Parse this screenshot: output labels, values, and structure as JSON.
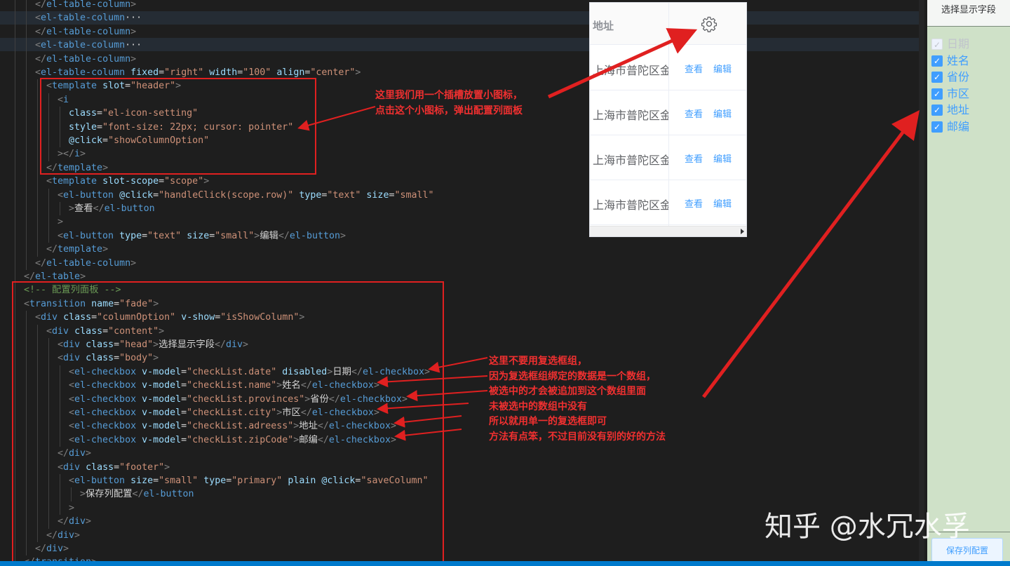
{
  "code_lines": [
    {
      "indent": 3,
      "html": "<span class='pn'>&lt;/</span><span class='tg'>el-table-column</span><span class='pn'>&gt;</span>"
    },
    {
      "indent": 3,
      "html": "<span class='pn'>&lt;</span><span class='tg'>el-table-column</span><span class='fold'>···</span>"
    },
    {
      "indent": 3,
      "html": "<span class='pn'>&lt;/</span><span class='tg'>el-table-column</span><span class='pn'>&gt;</span>"
    },
    {
      "indent": 3,
      "html": "<span class='pn'>&lt;</span><span class='tg'>el-table-column</span><span class='fold'>···</span>"
    },
    {
      "indent": 3,
      "html": "<span class='pn'>&lt;/</span><span class='tg'>el-table-column</span><span class='pn'>&gt;</span>"
    },
    {
      "indent": 3,
      "html": "<span class='pn'>&lt;</span><span class='tg'>el-table-column</span> <span class='at'>fixed</span>=<span class='st'>\"right\"</span> <span class='at'>width</span>=<span class='st'>\"100\"</span> <span class='at'>align</span>=<span class='st'>\"center\"</span><span class='pn'>&gt;</span>"
    },
    {
      "indent": 4,
      "html": "<span class='pn'>&lt;</span><span class='tg'>template</span> <span class='at'>slot</span>=<span class='st'>\"header\"</span><span class='pn'>&gt;</span>"
    },
    {
      "indent": 5,
      "html": "<span class='pn'>&lt;</span><span class='tg'>i</span>"
    },
    {
      "indent": 6,
      "html": "<span class='at'>class</span>=<span class='st'>\"el-icon-setting\"</span>"
    },
    {
      "indent": 6,
      "html": "<span class='at'>style</span>=<span class='st'>\"font-size: 22px; cursor: pointer\"</span>"
    },
    {
      "indent": 6,
      "html": "<span class='at'>@click</span>=<span class='st'>\"showColumnOption\"</span>"
    },
    {
      "indent": 5,
      "html": "<span class='pn'>&gt;&lt;/</span><span class='tg'>i</span><span class='pn'>&gt;</span>"
    },
    {
      "indent": 4,
      "html": "<span class='pn'>&lt;/</span><span class='tg'>template</span><span class='pn'>&gt;</span>"
    },
    {
      "indent": 4,
      "html": "<span class='pn'>&lt;</span><span class='tg'>template</span> <span class='at'>slot-scope</span>=<span class='st'>\"scope\"</span><span class='pn'>&gt;</span>"
    },
    {
      "indent": 5,
      "html": "<span class='pn'>&lt;</span><span class='tg'>el-button</span> <span class='at'>@click</span>=<span class='st'>\"handleClick(scope.row)\"</span> <span class='at'>type</span>=<span class='st'>\"text\"</span> <span class='at'>size</span>=<span class='st'>\"small\"</span>"
    },
    {
      "indent": 6,
      "html": "<span class='pn'>&gt;</span><span class='cjk'>查看</span><span class='pn'>&lt;/</span><span class='tg'>el-button</span>"
    },
    {
      "indent": 5,
      "html": "<span class='pn'>&gt;</span>"
    },
    {
      "indent": 5,
      "html": "<span class='pn'>&lt;</span><span class='tg'>el-button</span> <span class='at'>type</span>=<span class='st'>\"text\"</span> <span class='at'>size</span>=<span class='st'>\"small\"</span><span class='pn'>&gt;</span><span class='cjk'>编辑</span><span class='pn'>&lt;/</span><span class='tg'>el-button</span><span class='pn'>&gt;</span>"
    },
    {
      "indent": 4,
      "html": "<span class='pn'>&lt;/</span><span class='tg'>template</span><span class='pn'>&gt;</span>"
    },
    {
      "indent": 3,
      "html": "<span class='pn'>&lt;/</span><span class='tg'>el-table-column</span><span class='pn'>&gt;</span>"
    },
    {
      "indent": 2,
      "html": "<span class='pn'>&lt;/</span><span class='tg'>el-table</span><span class='pn'>&gt;</span>"
    },
    {
      "indent": 2,
      "html": "<span class='cm'>&lt;!-- <span class='cjk'>配置列面板</span> --&gt;</span>"
    },
    {
      "indent": 2,
      "html": "<span class='pn'>&lt;</span><span class='tg'>transition</span> <span class='at'>name</span>=<span class='st'>\"fade\"</span><span class='pn'>&gt;</span>"
    },
    {
      "indent": 3,
      "html": "<span class='pn'>&lt;</span><span class='tg'>div</span> <span class='at'>class</span>=<span class='st'>\"columnOption\"</span> <span class='at'>v-show</span>=<span class='st'>\"isShowColumn\"</span><span class='pn'>&gt;</span>"
    },
    {
      "indent": 4,
      "html": "<span class='pn'>&lt;</span><span class='tg'>div</span> <span class='at'>class</span>=<span class='st'>\"content\"</span><span class='pn'>&gt;</span>"
    },
    {
      "indent": 5,
      "html": "<span class='pn'>&lt;</span><span class='tg'>div</span> <span class='at'>class</span>=<span class='st'>\"head\"</span><span class='pn'>&gt;</span><span class='cjk'>选择显示字段</span><span class='pn'>&lt;/</span><span class='tg'>div</span><span class='pn'>&gt;</span>"
    },
    {
      "indent": 5,
      "html": "<span class='pn'>&lt;</span><span class='tg'>div</span> <span class='at'>class</span>=<span class='st'>\"body\"</span><span class='pn'>&gt;</span>"
    },
    {
      "indent": 6,
      "html": "<span class='pn'>&lt;</span><span class='tg'>el-checkbox</span> <span class='at'>v-model</span>=<span class='st'>\"checkList.date\"</span> <span class='at'>disabled</span><span class='pn'>&gt;</span><span class='cjk'>日期</span><span class='pn'>&lt;/</span><span class='tg'>el-checkbox</span><span class='pn'>&gt;</span>"
    },
    {
      "indent": 6,
      "html": "<span class='pn'>&lt;</span><span class='tg'>el-checkbox</span> <span class='at'>v-model</span>=<span class='st'>\"checkList.name\"</span><span class='pn'>&gt;</span><span class='cjk'>姓名</span><span class='pn'>&lt;/</span><span class='tg'>el-checkbox</span><span class='pn'>&gt;</span>"
    },
    {
      "indent": 6,
      "html": "<span class='pn'>&lt;</span><span class='tg'>el-checkbox</span> <span class='at'>v-model</span>=<span class='st'>\"checkList.provinces\"</span><span class='pn'>&gt;</span><span class='cjk'>省份</span><span class='pn'>&lt;/</span><span class='tg'>el-checkbox</span><span class='pn'>&gt;</span>"
    },
    {
      "indent": 6,
      "html": "<span class='pn'>&lt;</span><span class='tg'>el-checkbox</span> <span class='at'>v-model</span>=<span class='st'>\"checkList.city\"</span><span class='pn'>&gt;</span><span class='cjk'>市区</span><span class='pn'>&lt;/</span><span class='tg'>el-checkbox</span><span class='pn'>&gt;</span>"
    },
    {
      "indent": 6,
      "html": "<span class='pn'>&lt;</span><span class='tg'>el-checkbox</span> <span class='at'>v-model</span>=<span class='st'>\"checkList.adreess\"</span><span class='pn'>&gt;</span><span class='cjk'>地址</span><span class='pn'>&lt;/</span><span class='tg'>el-checkbox</span><span class='pn'>&gt;</span>"
    },
    {
      "indent": 6,
      "html": "<span class='pn'>&lt;</span><span class='tg'>el-checkbox</span> <span class='at'>v-model</span>=<span class='st'>\"checkList.zipCode\"</span><span class='pn'>&gt;</span><span class='cjk'>邮编</span><span class='pn'>&lt;/</span><span class='tg'>el-checkbox</span><span class='pn'>&gt;</span>"
    },
    {
      "indent": 5,
      "html": "<span class='pn'>&lt;/</span><span class='tg'>div</span><span class='pn'>&gt;</span>"
    },
    {
      "indent": 5,
      "html": "<span class='pn'>&lt;</span><span class='tg'>div</span> <span class='at'>class</span>=<span class='st'>\"footer\"</span><span class='pn'>&gt;</span>"
    },
    {
      "indent": 6,
      "html": "<span class='pn'>&lt;</span><span class='tg'>el-button</span> <span class='at'>size</span>=<span class='st'>\"small\"</span> <span class='at'>type</span>=<span class='st'>\"primary\"</span> <span class='at'>plain</span> <span class='at'>@click</span>=<span class='st'>\"saveColumn\"</span>"
    },
    {
      "indent": 7,
      "html": "<span class='pn'>&gt;</span><span class='cjk'>保存列配置</span><span class='pn'>&lt;/</span><span class='tg'>el-button</span>"
    },
    {
      "indent": 6,
      "html": "<span class='pn'>&gt;</span>"
    },
    {
      "indent": 5,
      "html": "<span class='pn'>&lt;/</span><span class='tg'>div</span><span class='pn'>&gt;</span>"
    },
    {
      "indent": 4,
      "html": "<span class='pn'>&lt;/</span><span class='tg'>div</span><span class='pn'>&gt;</span>"
    },
    {
      "indent": 3,
      "html": "<span class='pn'>&lt;/</span><span class='tg'>div</span><span class='pn'>&gt;</span>"
    },
    {
      "indent": 2,
      "html": "<span class='pn'>&lt;/</span><span class='tg'>transition</span><span class='pn'>&gt;</span>"
    }
  ],
  "table": {
    "header_address": "地址",
    "gear_icon": "gear-icon",
    "rows": [
      {
        "address": "上海市普陀区金",
        "view": "查看",
        "edit": "编辑"
      },
      {
        "address": "上海市普陀区金",
        "view": "查看",
        "edit": "编辑"
      },
      {
        "address": "上海市普陀区金",
        "view": "查看",
        "edit": "编辑"
      },
      {
        "address": "上海市普陀区金",
        "view": "查看",
        "edit": "编辑"
      }
    ]
  },
  "column_panel": {
    "title": "选择显示字段",
    "options": [
      {
        "label": "日期",
        "checked": true,
        "disabled": true
      },
      {
        "label": "姓名",
        "checked": true,
        "disabled": false
      },
      {
        "label": "省份",
        "checked": true,
        "disabled": false
      },
      {
        "label": "市区",
        "checked": true,
        "disabled": false
      },
      {
        "label": "地址",
        "checked": true,
        "disabled": false
      },
      {
        "label": "邮编",
        "checked": true,
        "disabled": false
      }
    ],
    "save_label": "保存列配置"
  },
  "annotations": {
    "slot_note": "这里我们用一个插槽放置小图标，\n点击这个小图标，弹出配置列面板",
    "checkbox_note": "这里不要用复选框组，\n因为复选框组绑定的数据是一个数组，\n被选中的才会被追加到这个数组里面\n未被选中的数组中没有\n所以就用单一的复选框即可\n方法有点笨，不过目前没有别的好的方法"
  },
  "watermark": "知乎 @水冗水孚",
  "colors": {
    "editor_bg": "#1e1e1e",
    "tag": "#569cd6",
    "attr": "#9cdcfe",
    "string": "#ce9178",
    "annotation_red": "#e02020",
    "element_blue": "#409eff",
    "panel_green": "#cfe1c8"
  }
}
